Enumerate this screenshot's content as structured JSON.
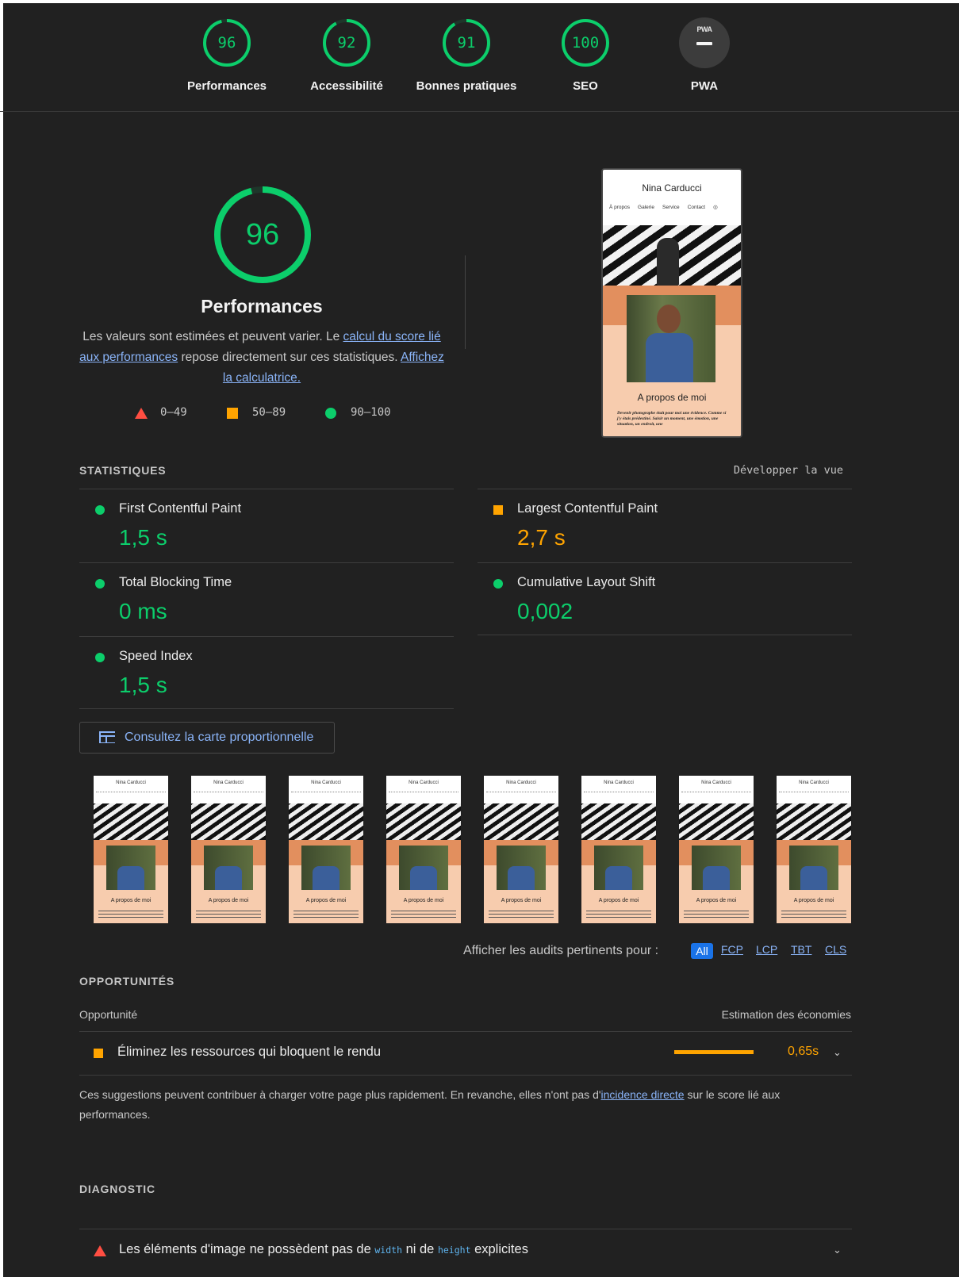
{
  "top_scores": [
    {
      "score": "96",
      "label": "Performances",
      "value": 96
    },
    {
      "score": "92",
      "label": "Accessibilité",
      "value": 92
    },
    {
      "score": "91",
      "label": "Bonnes pratiques",
      "value": 91
    },
    {
      "score": "100",
      "label": "SEO",
      "value": 100
    }
  ],
  "pwa": {
    "badge": "PWA",
    "label": "PWA"
  },
  "main": {
    "score": "96",
    "score_value": 96,
    "title": "Performances",
    "desc_1": "Les valeurs sont estimées et peuvent varier. Le ",
    "link_1": "calcul du score lié aux performances",
    "desc_2": " repose directement sur ces statistiques. ",
    "link_2": "Affichez la calculatrice."
  },
  "legend": {
    "fail": "0–49",
    "average": "50–89",
    "pass": "90–100"
  },
  "preview": {
    "site_title": "Nina Carducci",
    "nav": [
      "À propos",
      "Galerie",
      "Service",
      "Contact"
    ],
    "about_title": "A propos de moi",
    "about_text": "Devenir photographe était pour moi une évidence. Comme si j'y étais prédestiné. Saisir un moment, une émotion, une situation, un endroit, une"
  },
  "statistics": {
    "heading": "STATISTIQUES",
    "expand_label": "Développer la vue",
    "metrics": [
      {
        "name": "First Contentful Paint",
        "value": "1,5 s",
        "status": "pass"
      },
      {
        "name": "Largest Contentful Paint",
        "value": "2,7 s",
        "status": "average"
      },
      {
        "name": "Total Blocking Time",
        "value": "0 ms",
        "status": "pass"
      },
      {
        "name": "Cumulative Layout Shift",
        "value": "0,002",
        "status": "pass"
      },
      {
        "name": "Speed Index",
        "value": "1,5 s",
        "status": "pass"
      }
    ]
  },
  "treemap_button": "Consultez la carte proportionnelle",
  "filmstrip": {
    "frame_count": 8,
    "site_title": "Nina Carducci",
    "about_title": "A propos de moi"
  },
  "filter": {
    "label": "Afficher les audits pertinents pour :",
    "options": [
      "All",
      "FCP",
      "LCP",
      "TBT",
      "CLS"
    ],
    "selected": "All"
  },
  "opportunities": {
    "heading": "OPPORTUNITÉS",
    "col_left": "Opportunité",
    "col_right": "Estimation des économies",
    "items": [
      {
        "title": "Éliminez les ressources qui bloquent le rendu",
        "savings": "0,65s"
      }
    ],
    "note_1": "Ces suggestions peuvent contribuer à charger votre page plus rapidement. En revanche, elles n'ont pas d'",
    "note_link": "incidence directe",
    "note_2": " sur le score lié aux performances."
  },
  "diagnostic": {
    "heading": "DIAGNOSTIC",
    "item_pre": "Les éléments d'image ne possèdent pas de ",
    "code_1": "width",
    "item_mid": " ni de ",
    "code_2": "height",
    "item_post": " explicites"
  },
  "colors": {
    "pass": "#0cce6b",
    "average": "#ffa400",
    "fail": "#ff4e42",
    "link": "#8ab4f8",
    "background": "#212121"
  }
}
